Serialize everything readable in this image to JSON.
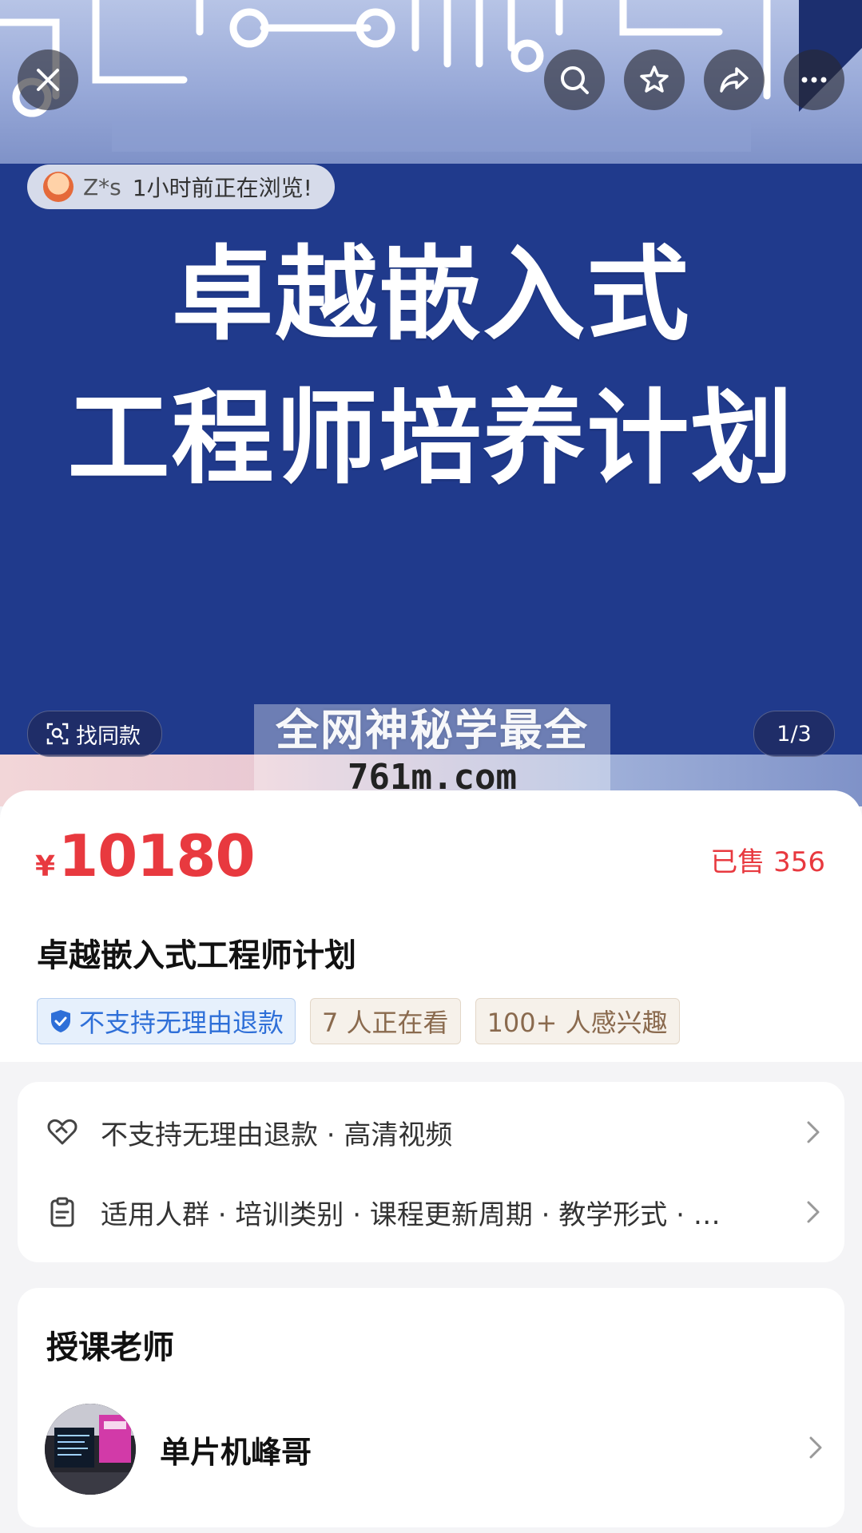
{
  "header": {
    "close_icon": "close-icon",
    "search_icon": "search-icon",
    "favorite_icon": "star-icon",
    "share_icon": "share-icon",
    "more_icon": "more-icon"
  },
  "hero": {
    "browsing": {
      "user": "Z*s",
      "text": "1小时前正在浏览!"
    },
    "title_line1": "卓越嵌入式",
    "title_line2": "工程师培养计划",
    "find_same_label": "找同款",
    "page_indicator": "1/3",
    "watermark_line1": "全网神秘学最全",
    "watermark_line2": "761m.com"
  },
  "product": {
    "currency": "¥",
    "price": "10180",
    "sold": "已售 356",
    "title": "卓越嵌入式工程师计划",
    "tags": {
      "refund": "不支持无理由退款",
      "watching": "7 人正在看",
      "interested": "100+ 人感兴趣"
    }
  },
  "info": {
    "row1": "不支持无理由退款 · 高清视频",
    "row2": "适用人群 · 培训类别 · 课程更新周期 · 教学形式 · …"
  },
  "teacher": {
    "heading": "授课老师",
    "name": "单片机峰哥"
  },
  "colors": {
    "price_red": "#e8393f",
    "hero_blue": "#203a8c",
    "tag_blue": "#2e6fd8",
    "tag_brown": "#8a6a4e"
  }
}
